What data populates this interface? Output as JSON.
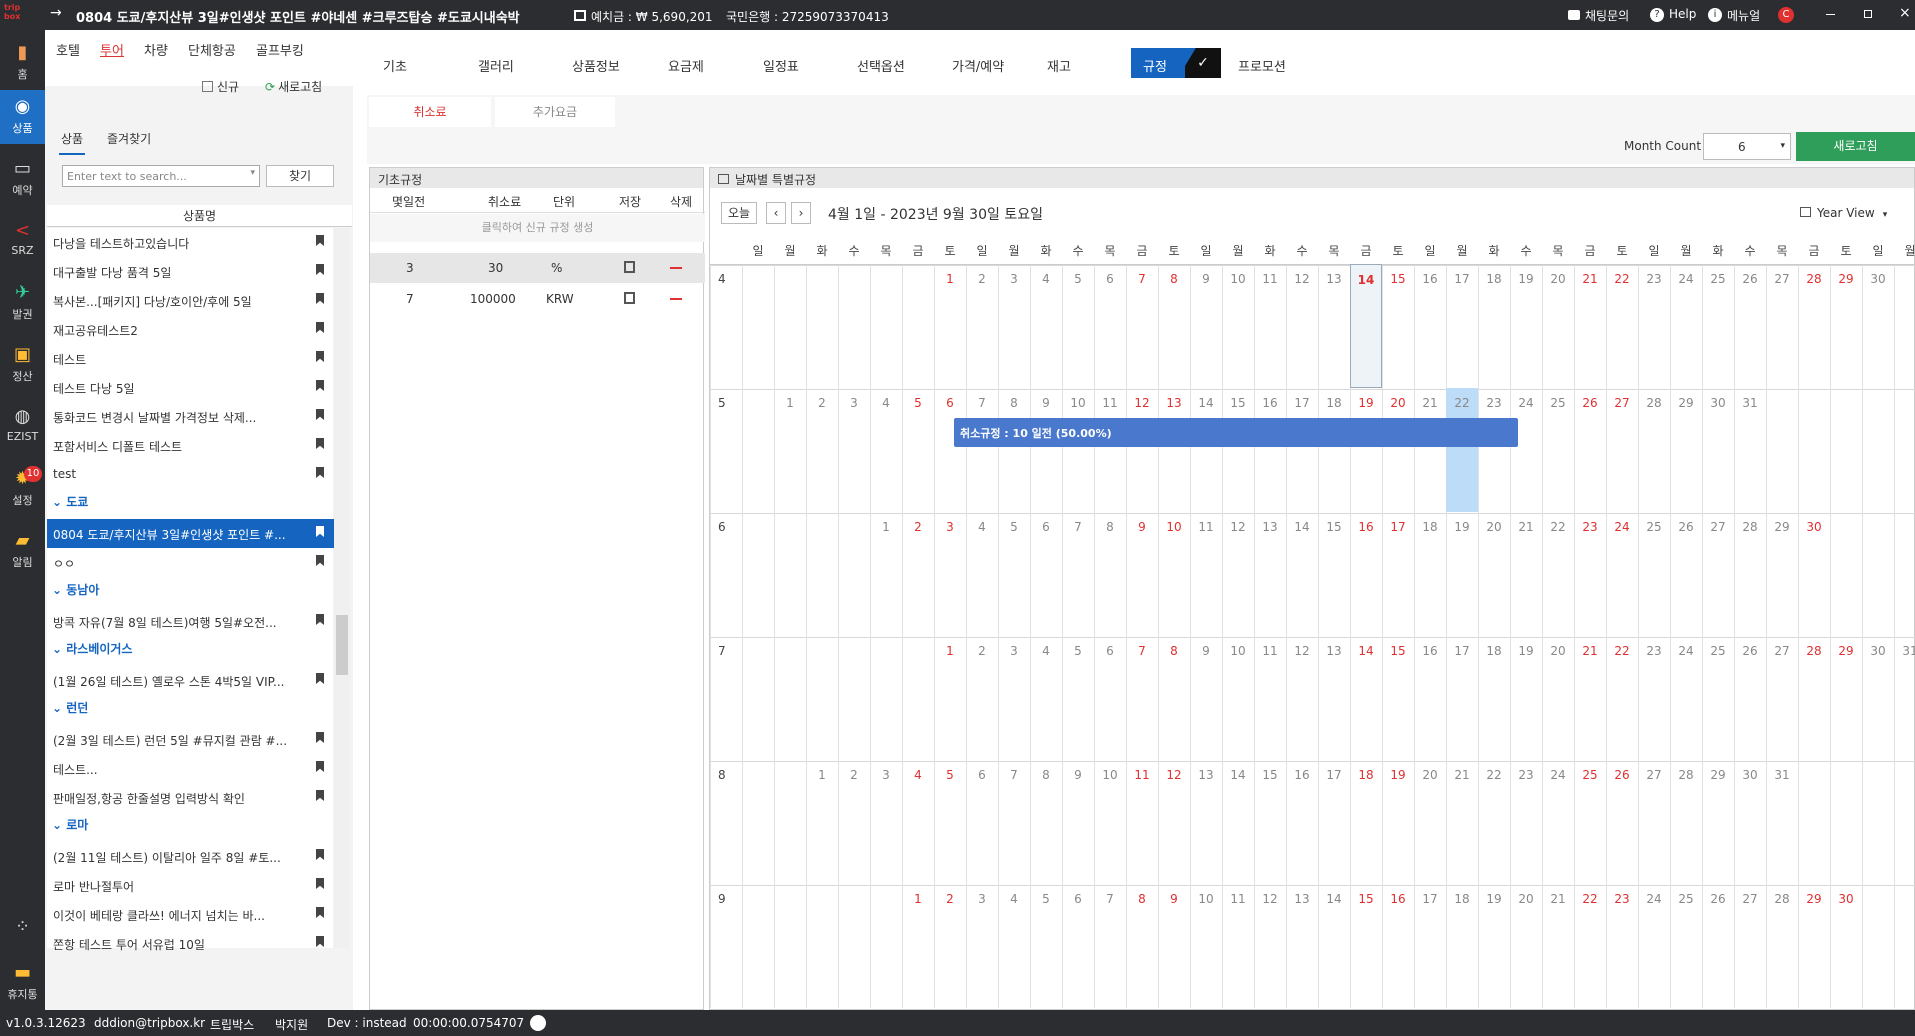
{
  "title": {
    "arrow": "→",
    "text": "0804 도쿄/후지산뷰 3일#인생샷 포인트 #야네센 #크루즈탑승 #도쿄시내숙박",
    "deposit": "예치금 : ₩ 5,690,201",
    "bank": "국민은행 : 27259073370413",
    "chat": "채팅문의",
    "help": "Help",
    "manual": "메뉴얼"
  },
  "leftbar": {
    "logo": "trip box",
    "items": [
      {
        "label": "홈",
        "icon": "home-chart-icon"
      },
      {
        "label": "상품",
        "icon": "globe-icon"
      },
      {
        "label": "예약",
        "icon": "monitor-icon"
      },
      {
        "label": "SRZ",
        "icon": "share-icon"
      },
      {
        "label": "발권",
        "icon": "plane-icon"
      },
      {
        "label": "정산",
        "icon": "wallet-icon"
      },
      {
        "label": "EZIST",
        "icon": "globe2-icon"
      },
      {
        "label": "설정",
        "icon": "gear-icon",
        "badge": "10"
      },
      {
        "label": "알림",
        "icon": "chat-icon"
      },
      {
        "label": "휴지통",
        "icon": "trash-icon"
      }
    ]
  },
  "top_tabs": [
    "호텔",
    "투어",
    "차량",
    "단체항공",
    "골프부킹"
  ],
  "sub_tabs": [
    "기초",
    "갤러리",
    "상품정보",
    "요금제",
    "일정표",
    "선택옵션",
    "가격/예약",
    "재고",
    "규정",
    "프로모션"
  ],
  "left_panel": {
    "new_btn": "신규",
    "refresh_btn": "새로고침",
    "tabs": [
      "상품",
      "즐겨찾기"
    ],
    "search_placeholder": "Enter text to search...",
    "find_btn": "찾기",
    "col_header": "상품명",
    "items": [
      {
        "type": "item",
        "text": "다낭을 테스트하고있습니다"
      },
      {
        "type": "item",
        "text": "대구출발 다낭 품격 5일"
      },
      {
        "type": "item",
        "text": "복사본...[패키지] 다낭/호이안/후에 5일"
      },
      {
        "type": "item",
        "text": "재고공유테스트2"
      },
      {
        "type": "item",
        "text": "테스트"
      },
      {
        "type": "item",
        "text": "테스트 다낭 5일"
      },
      {
        "type": "item",
        "text": "통화코드 변경시 날짜별 가격정보 삭제..."
      },
      {
        "type": "item",
        "text": "포함서비스 디폴트 테스트"
      },
      {
        "type": "item",
        "text": "test"
      },
      {
        "type": "group",
        "text": "도쿄"
      },
      {
        "type": "item",
        "text": "0804 도쿄/후지산뷰 3일#인생샷 포인트 #...",
        "selected": true
      },
      {
        "type": "item",
        "text": "ㅇㅇ"
      },
      {
        "type": "group",
        "text": "동남아"
      },
      {
        "type": "item",
        "text": "방콕 자유(7월 8일 테스트)여행 5일#오전..."
      },
      {
        "type": "group",
        "text": "라스베이거스"
      },
      {
        "type": "item",
        "text": "(1월 26일 테스트) 옐로우 스톤 4박5일 VIP..."
      },
      {
        "type": "group",
        "text": "런던"
      },
      {
        "type": "item",
        "text": "(2월 3일 테스트) 런던 5일 #뮤지컬 관람 #..."
      },
      {
        "type": "item",
        "text": "테스트..."
      },
      {
        "type": "item",
        "text": "판매일정,항공 한줄설명 입력방식 확인"
      },
      {
        "type": "group",
        "text": "로마"
      },
      {
        "type": "item",
        "text": "(2월 11일 테스트) 이탈리아 일주 8일 #토..."
      },
      {
        "type": "item",
        "text": "로마 반나절투어"
      },
      {
        "type": "item",
        "text": "이것이 베테랑 클라쓰! 에너지 넘치는 바..."
      },
      {
        "type": "item",
        "text": "쫀항 테스트 투어 서유럽 10일"
      }
    ]
  },
  "rule_tabs": [
    "취소료",
    "추가요금"
  ],
  "month_count": {
    "label": "Month Count",
    "value": "6",
    "refresh": "새로고침"
  },
  "base_rules": {
    "title": "기초규정",
    "headers": [
      "몇일전",
      "취소료",
      "단위",
      "저장",
      "삭제"
    ],
    "placeholder": "클릭하여 신규 규정 생성",
    "rows": [
      [
        "3",
        "30",
        "%"
      ],
      [
        "7",
        "100000",
        "KRW"
      ]
    ]
  },
  "calendar": {
    "title": "날짜별 특별규정",
    "today": "오늘",
    "range": "4월 1일 - 2023년 9월 30일 토요일",
    "view": "Year View",
    "weekdays": [
      "일",
      "월",
      "화",
      "수",
      "목",
      "금",
      "토"
    ],
    "months": [
      {
        "m": "4",
        "start": 6,
        "days": 30
      },
      {
        "m": "5",
        "start": 1,
        "days": 31
      },
      {
        "m": "6",
        "start": 4,
        "days": 30
      },
      {
        "m": "7",
        "start": 6,
        "days": 31
      },
      {
        "m": "8",
        "start": 2,
        "days": 31
      },
      {
        "m": "9",
        "start": 5,
        "days": 30
      }
    ],
    "event": "취소규정 : 10 일전 (50.00%)",
    "today_cell": "4-14",
    "highlight": "5-22"
  },
  "status": {
    "version": "v1.0.3.12623",
    "user": "dddion@tripbox.kr",
    "company": "트립박스",
    "name": "박지원",
    "dev": "Dev : instead",
    "time": "00:00:00.0754707"
  },
  "colors": {
    "accent": "#1565c0",
    "red": "#e03030",
    "green": "#2e9e5a",
    "event": "#4a78cc"
  }
}
